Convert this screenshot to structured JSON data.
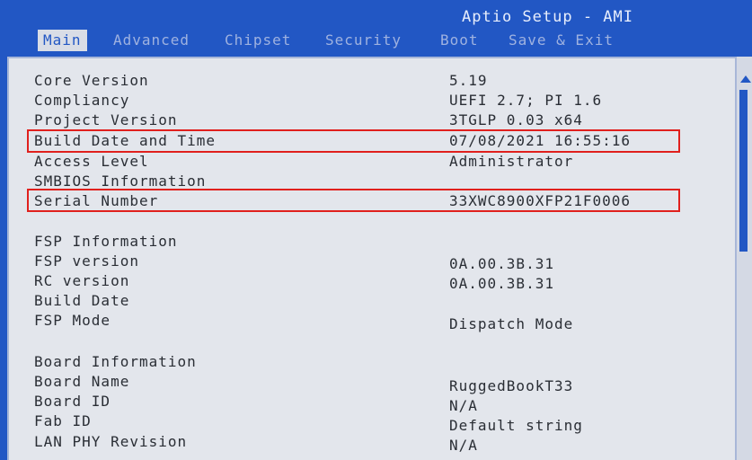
{
  "app_title": "Aptio Setup - AMI",
  "tabs": [
    {
      "label": "Main"
    },
    {
      "label": "Advanced"
    },
    {
      "label": "Chipset"
    },
    {
      "label": "Security"
    },
    {
      "label": "Boot"
    },
    {
      "label": "Save & Exit"
    }
  ],
  "active_tab": "Main",
  "rows": [
    {
      "label": "Core Version",
      "value": "5.19"
    },
    {
      "label": "Compliancy",
      "value": "UEFI 2.7; PI 1.6"
    },
    {
      "label": "Project Version",
      "value": "3TGLP 0.03 x64"
    },
    {
      "label": "Build Date and Time",
      "value": "07/08/2021 16:55:16"
    },
    {
      "label": "Access Level",
      "value": "Administrator"
    },
    {
      "label": "SMBIOS Information",
      "value": ""
    },
    {
      "label": "Serial Number",
      "value": "33XWC8900XFP21F0006"
    },
    {
      "label": "FSP Information",
      "value": ""
    },
    {
      "label": "FSP version",
      "value": "0A.00.3B.31"
    },
    {
      "label": "RC version",
      "value": "0A.00.3B.31"
    },
    {
      "label": "Build Date",
      "value": ""
    },
    {
      "label": "FSP Mode",
      "value": "Dispatch Mode"
    },
    {
      "label": "Board Information",
      "value": ""
    },
    {
      "label": "Board Name",
      "value": "RuggedBookT33"
    },
    {
      "label": "Board ID",
      "value": "N/A"
    },
    {
      "label": "Fab ID",
      "value": "Default string"
    },
    {
      "label": "LAN PHY Revision",
      "value": "N/A"
    }
  ],
  "colors": {
    "header_blue": "#2257c4",
    "panel_bg": "#e3e6ec",
    "highlight_red": "#e0201d"
  }
}
